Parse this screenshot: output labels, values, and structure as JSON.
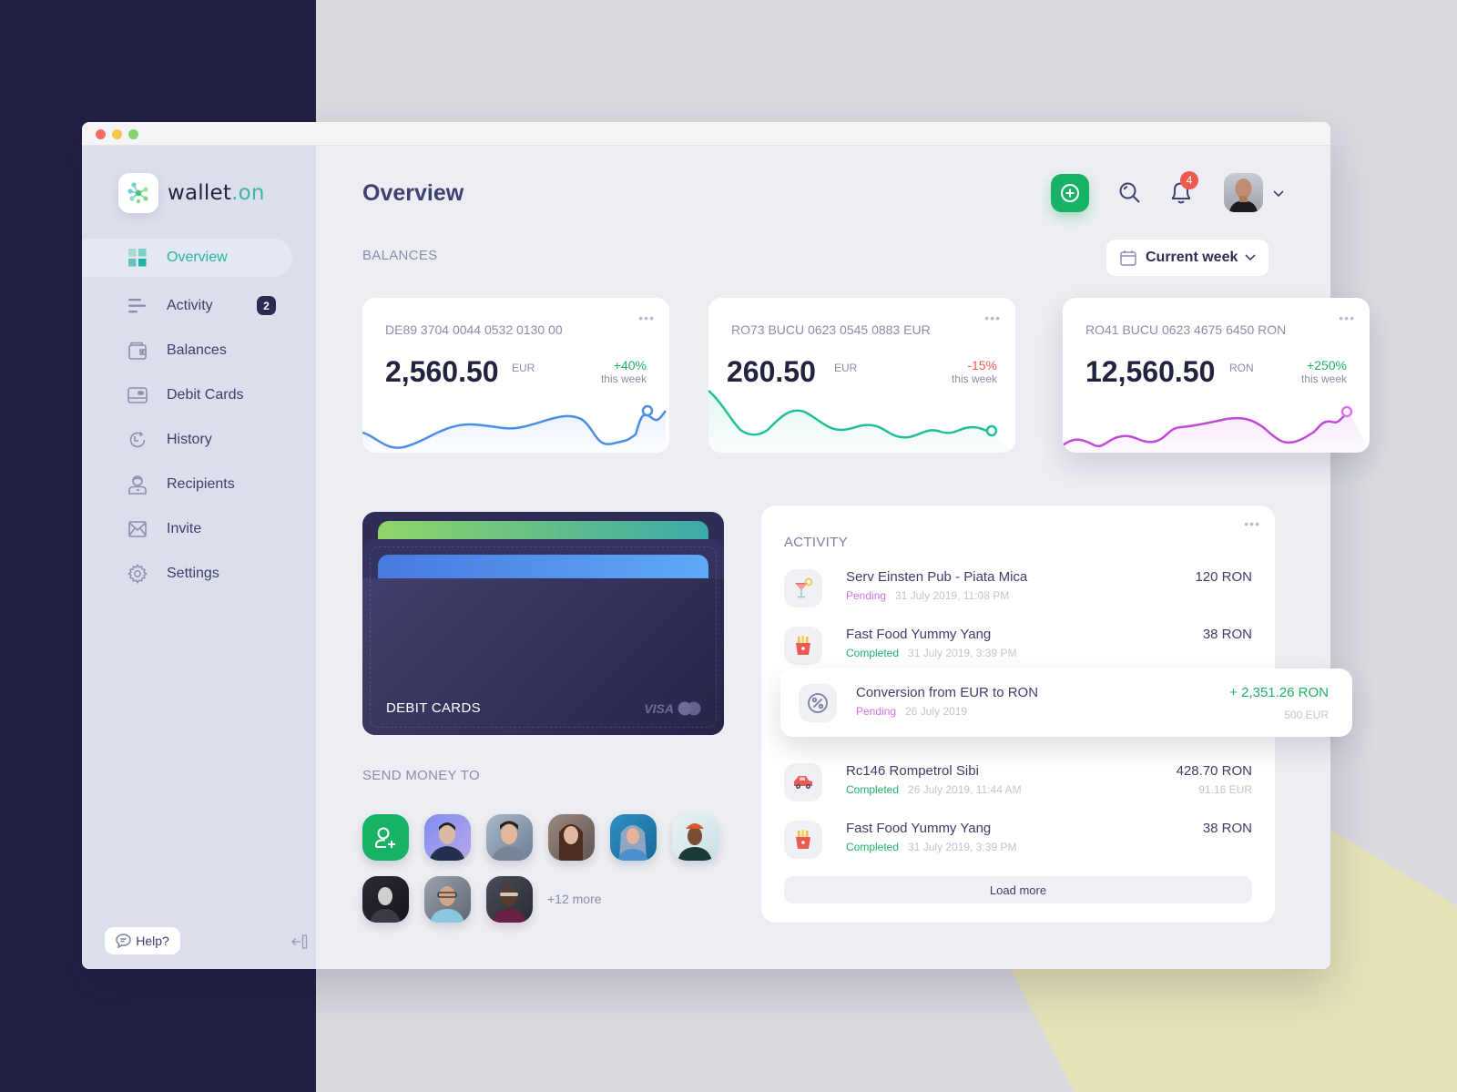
{
  "window": {
    "controls": [
      "close",
      "minimize",
      "maximize"
    ]
  },
  "brand": {
    "name": "wallet",
    "suffix": ".on"
  },
  "sidebar": {
    "items": [
      {
        "label": "Overview",
        "icon": "grid-icon",
        "active": true
      },
      {
        "label": "Activity",
        "icon": "activity-icon",
        "badge": "2"
      },
      {
        "label": "Balances",
        "icon": "wallet-icon"
      },
      {
        "label": "Debit Cards",
        "icon": "card-icon"
      },
      {
        "label": "History",
        "icon": "history-icon"
      },
      {
        "label": "Recipients",
        "icon": "recipients-icon"
      },
      {
        "label": "Invite",
        "icon": "mail-icon"
      },
      {
        "label": "Settings",
        "icon": "gear-icon"
      }
    ],
    "help_label": "Help?"
  },
  "header": {
    "title": "Overview",
    "notifications_count": "4"
  },
  "balances": {
    "label": "BALANCES",
    "period": "Current week",
    "cards": [
      {
        "iban": "DE89 3704 0044 0532 0130 00",
        "amount": "2,560.50",
        "currency": "EUR",
        "change": "+40%",
        "change_label": "this week",
        "trend": "up",
        "color": "#4a8ee8"
      },
      {
        "iban": "RO73 BUCU 0623 0545 0883 EUR",
        "amount": "260.50",
        "currency": "EUR",
        "change": "-15%",
        "change_label": "this week",
        "trend": "down",
        "color": "#1fbf9a"
      },
      {
        "iban": "RO41 BUCU 0623 4675 6450 RON",
        "amount": "12,560.50",
        "currency": "RON",
        "change": "+250%",
        "change_label": "this week",
        "trend": "up",
        "color": "#c04bd8"
      }
    ]
  },
  "debit_cards": {
    "label": "DEBIT CARDS",
    "brand_text": "VISA"
  },
  "send_money": {
    "label": "SEND MONEY TO",
    "more": "+12 more",
    "recipient_count": 9
  },
  "activity": {
    "title": "ACTIVITY",
    "items": [
      {
        "name": "Serv Einsten Pub - Piata Mica",
        "status": "Pending",
        "date": "31 July 2019, 11:08 PM",
        "amount": "120 RON",
        "sub": "",
        "icon": "cocktail-icon"
      },
      {
        "name": "Fast Food Yummy Yang",
        "status": "Completed",
        "date": "31 July 2019, 3:39 PM",
        "amount": "38 RON",
        "sub": "",
        "icon": "fries-icon"
      },
      {
        "name": "Conversion from EUR to RON",
        "status": "Pending",
        "date": "26 July 2019",
        "amount": "+ 2,351.26 RON",
        "sub": "500 EUR",
        "icon": "percent-icon"
      },
      {
        "name": "Rc146 Rompetrol Sibi",
        "status": "Completed",
        "date": "26 July 2019, 11:44 AM",
        "amount": "428.70 RON",
        "sub": "91.16 EUR",
        "icon": "car-icon"
      },
      {
        "name": "Fast Food Yummy Yang",
        "status": "Completed",
        "date": "31 July 2019, 3:39 PM",
        "amount": "38 RON",
        "sub": "",
        "icon": "fries-icon"
      }
    ],
    "load_more": "Load more"
  }
}
